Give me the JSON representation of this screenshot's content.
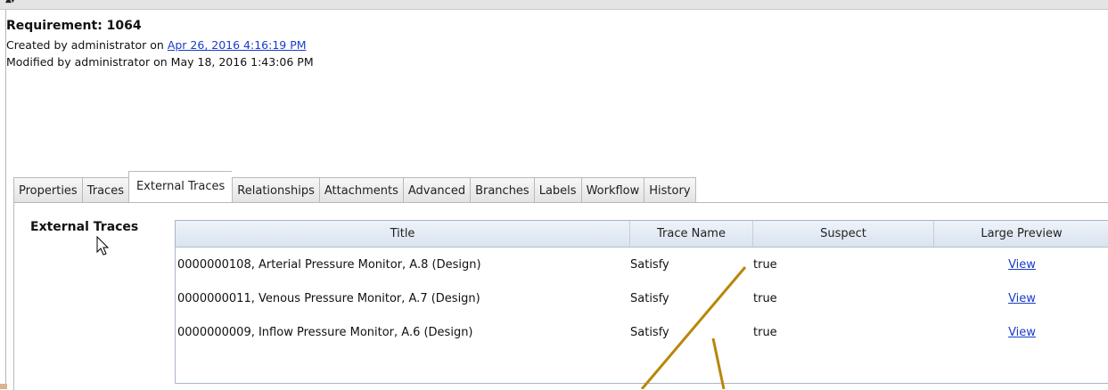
{
  "requirement": {
    "title": "Requirement: 1064",
    "created_prefix": "Created by administrator on ",
    "created_date": "Apr 26, 2016 4:16:19 PM",
    "modified": "Modified by administrator on May 18, 2016 1:43:06 PM"
  },
  "tabs": [
    {
      "label": "Properties",
      "active": false
    },
    {
      "label": "Traces",
      "active": false
    },
    {
      "label": "External Traces",
      "active": true
    },
    {
      "label": "Relationships",
      "active": false
    },
    {
      "label": "Attachments",
      "active": false
    },
    {
      "label": "Advanced",
      "active": false
    },
    {
      "label": "Branches",
      "active": false
    },
    {
      "label": "Labels",
      "active": false
    },
    {
      "label": "Workflow",
      "active": false
    },
    {
      "label": "History",
      "active": false
    }
  ],
  "external_traces": {
    "section_label": "External Traces",
    "columns": [
      "Title",
      "Trace Name",
      "Suspect",
      "Large Preview"
    ],
    "rows": [
      {
        "title": "0000000108, Arterial Pressure Monitor, A.8 (Design)",
        "trace_name": "Satisfy",
        "suspect": "true",
        "preview": "View"
      },
      {
        "title": "0000000011, Venous Pressure Monitor, A.7 (Design)",
        "trace_name": "Satisfy",
        "suspect": "true",
        "preview": "View"
      },
      {
        "title": "0000000009, Inflow Pressure Monitor, A.6 (Design)",
        "trace_name": "Satisfy",
        "suspect": "true",
        "preview": "View"
      }
    ]
  },
  "colors": {
    "link": "#1a3cc8",
    "callout": "#b8860b"
  },
  "icons": [
    "collapse-arrows-icon",
    "mouse-pointer-icon"
  ]
}
